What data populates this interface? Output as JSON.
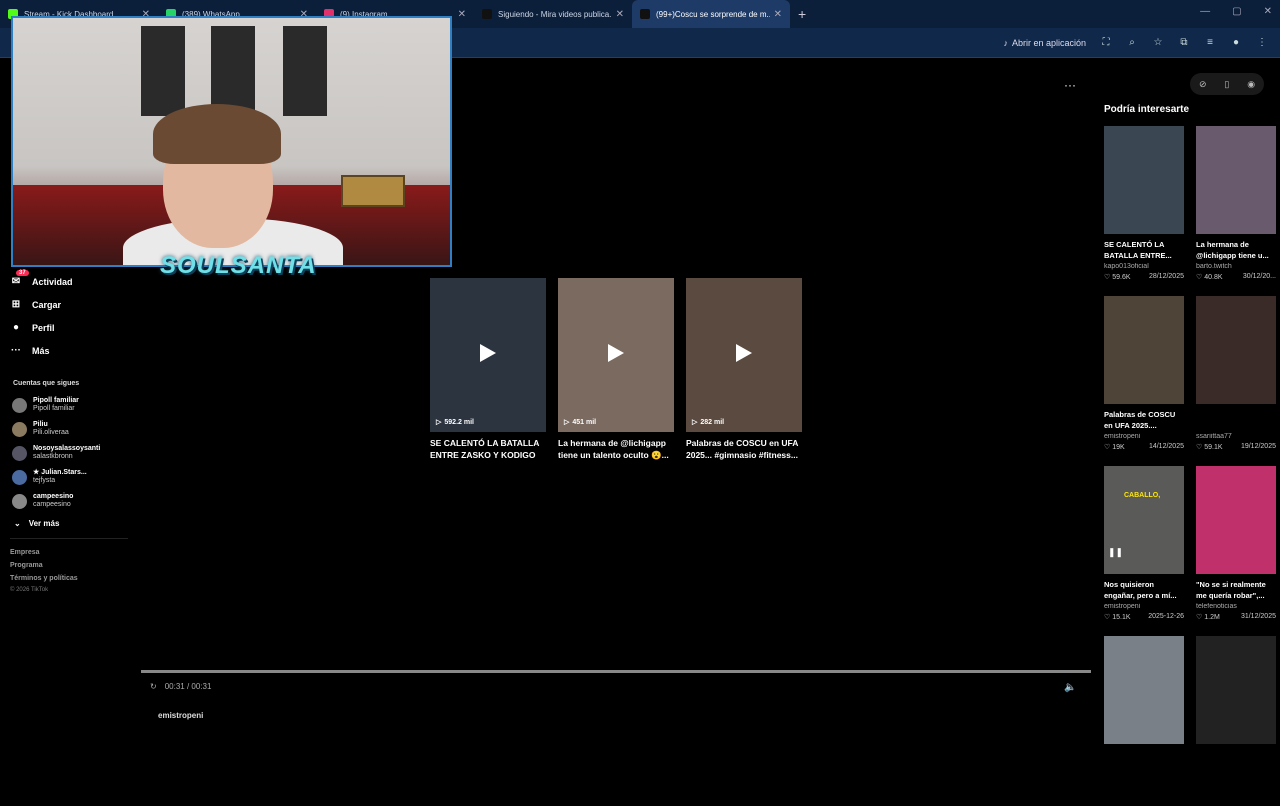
{
  "browser": {
    "tabs": [
      {
        "label": "Stream - Kick Dashboard",
        "color": "#53fc18"
      },
      {
        "label": "(389) WhatsApp",
        "color": "#25d366"
      },
      {
        "label": "(9) Instagram",
        "color": "#e1306c"
      },
      {
        "label": "Siguiendo - Mira videos publica...",
        "color": "#111111"
      },
      {
        "label": "(99+)Coscu se sorprende de m...",
        "color": "#111111"
      }
    ],
    "new_tab": "+",
    "open_in_app": "Abrir en aplicación"
  },
  "overlay": {
    "streamer_name": "SOULSANTA"
  },
  "sidebar": {
    "items": [
      {
        "label": "Actividad",
        "icon": "activity-icon",
        "glyph": "✉",
        "badge": "37"
      },
      {
        "label": "Cargar",
        "icon": "upload-icon",
        "glyph": "⊞"
      },
      {
        "label": "Perfil",
        "icon": "profile-icon",
        "glyph": "●"
      },
      {
        "label": "Más",
        "icon": "more-icon",
        "glyph": "···"
      }
    ],
    "following_title": "Cuentas que sigues",
    "following": [
      {
        "name": "Pipoll familiar",
        "handle": "Pipoll familiar"
      },
      {
        "name": "Piliu",
        "handle": "Pili.oliveraa"
      },
      {
        "name": "Nosoysalassoysanti",
        "handle": "salastkbronn"
      },
      {
        "name": "★ Julian.Stars...",
        "handle": "tejfysta"
      },
      {
        "name": "campeesino",
        "handle": "campeesino"
      }
    ],
    "see_more": "Ver más",
    "footer": [
      "Empresa",
      "Programa",
      "Términos y políticas"
    ],
    "copyright": "© 2026 TikTok"
  },
  "grid": [
    {
      "views": "592.2 mil",
      "title": "SE CALENTÓ LA BATALLA ENTRE ZASKO Y KODIGO",
      "bg": "#2c3440"
    },
    {
      "views": "451 mil",
      "title": "La hermana de @lichigapp tiene un talento oculto 😮...",
      "bg": "#7a6a60"
    },
    {
      "views": "282 mil",
      "title": "Palabras de COSCU en UFA 2025... #gimnasio #fitness...",
      "bg": "#5a4a40"
    }
  ],
  "player": {
    "time": "00:31 / 00:31",
    "progress": 1.0,
    "author": "emistropeni"
  },
  "right": {
    "title": "Podría interesarte",
    "items": [
      {
        "title": "SE CALENTÓ LA BATALLA ENTRE...",
        "author": "kapo013oficial",
        "likes": "59.6K",
        "date": "28/12/2025",
        "bg": "#3a4652"
      },
      {
        "title": "La hermana de @lichigapp tiene u...",
        "author": "barto.twitch",
        "likes": "40.8K",
        "date": "30/12/20...",
        "bg": "#6a5a6e"
      },
      {
        "title": "Palabras de COSCU en UFA 2025....",
        "author": "emistropeni",
        "likes": "19K",
        "date": "14/12/2025",
        "bg": "#4e4438"
      },
      {
        "title": "",
        "author": "ssariittaa77",
        "likes": "59.1K",
        "date": "19/12/2025",
        "bg": "#3a2a28"
      },
      {
        "title": "Nos quisieron engañar, pero a mí...",
        "author": "emistropeni",
        "likes": "15.1K",
        "date": "2025-12-26",
        "bg": "#5a5a58",
        "caption": "CABALLO,",
        "paused": true
      },
      {
        "title": "\"No se si realmente me quería robar\",...",
        "author": "telefenoticias",
        "likes": "1.2M",
        "date": "31/12/2025",
        "bg": "#c0306a"
      },
      {
        "title": "",
        "author": "",
        "likes": "",
        "date": "",
        "bg": "#7a8088"
      },
      {
        "title": "",
        "author": "",
        "likes": "",
        "date": "",
        "bg": "#222222"
      }
    ]
  }
}
